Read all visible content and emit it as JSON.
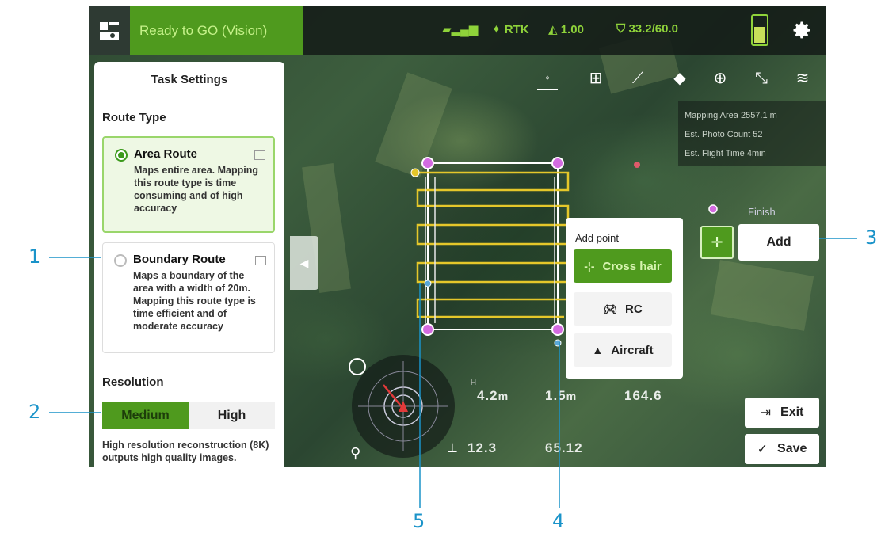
{
  "app": {
    "status_text": "Ready to GO (Vision)",
    "telemetry_top": {
      "signal": "",
      "rtk": "RTK",
      "distance": "1.00",
      "battery": "33.2/60.0"
    }
  },
  "toolbar": {
    "items": [
      "cursor-icon",
      "add-folder-icon",
      "ruler-icon",
      "eraser-icon",
      "add-route-icon",
      "reverse-icon",
      "layers-icon"
    ]
  },
  "info_box": {
    "rows": [
      {
        "label": "Mapping Area",
        "value": "2557.1 m"
      },
      {
        "label": "Est. Photo Count",
        "value": "52"
      },
      {
        "label": "Est. Flight Time",
        "value": "4min"
      }
    ]
  },
  "task_settings": {
    "title": "Task Settings",
    "route_type_heading": "Route Type",
    "area_route": {
      "name": "Area Route",
      "description": "Maps entire area. Mapping this route type is time consuming and of high accuracy",
      "selected": true
    },
    "boundary_route": {
      "name": "Boundary Route",
      "description": "Maps a boundary of the area with a width of 20m. Mapping this route type is time efficient and of moderate accuracy",
      "selected": false
    },
    "resolution_heading": "Resolution",
    "resolution_options": [
      "Medium",
      "High"
    ],
    "resolution_selected": "Medium",
    "resolution_note": "High resolution reconstruction (8K) outputs high quality images."
  },
  "add_point": {
    "title": "Add point",
    "options": [
      "Cross hair",
      "RC",
      "Aircraft"
    ],
    "selected": "Cross hair",
    "add_button": "Add",
    "finish_label": "Finish"
  },
  "action_buttons": {
    "exit": "Exit",
    "save": "Save"
  },
  "telemetry_bottom": {
    "row1": [
      "4.2",
      "1.5",
      "164.6"
    ],
    "row2": [
      "12.3",
      "65.12"
    ],
    "row1_units": [
      "m",
      "m",
      ""
    ],
    "row2_units": [
      "",
      ""
    ]
  },
  "callouts": [
    "1",
    "2",
    "3",
    "4",
    "5"
  ],
  "colors": {
    "accent_green": "#4f9a1e",
    "route_yellow": "#e5c72a",
    "vertex_magenta": "#d36be0",
    "callout_blue": "#1a93c9"
  }
}
